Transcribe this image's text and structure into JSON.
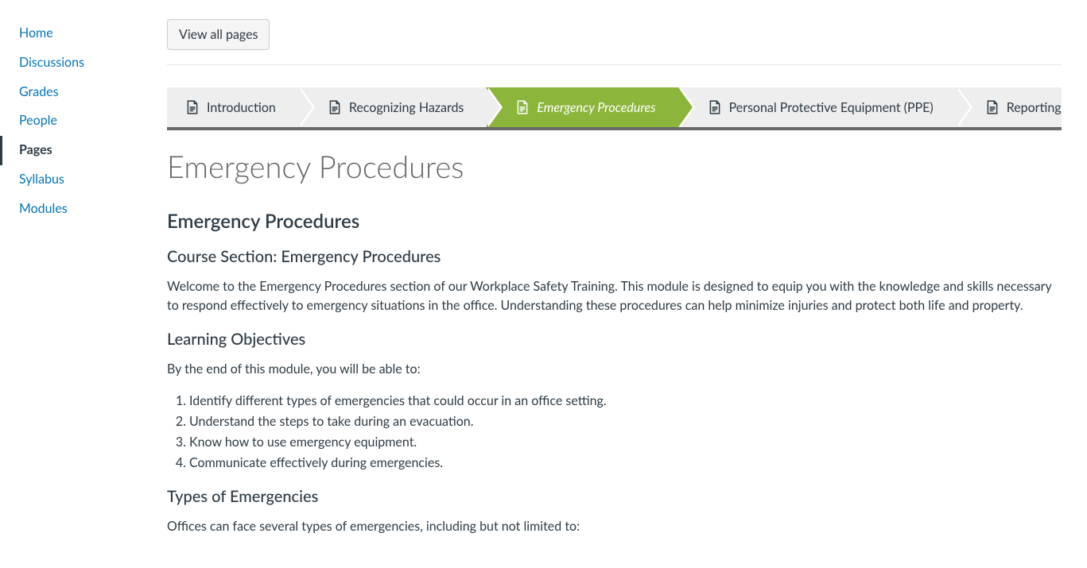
{
  "sidebar": {
    "items": [
      {
        "label": "Home",
        "active": false
      },
      {
        "label": "Discussions",
        "active": false
      },
      {
        "label": "Grades",
        "active": false
      },
      {
        "label": "People",
        "active": false
      },
      {
        "label": "Pages",
        "active": true
      },
      {
        "label": "Syllabus",
        "active": false
      },
      {
        "label": "Modules",
        "active": false
      }
    ]
  },
  "header": {
    "view_all_label": "View all pages"
  },
  "breadcrumb": {
    "items": [
      {
        "label": "Introduction",
        "active": false
      },
      {
        "label": "Recognizing Hazards",
        "active": false
      },
      {
        "label": "Emergency Procedures",
        "active": true
      },
      {
        "label": "Personal Protective Equipment (PPE)",
        "active": false
      },
      {
        "label": "Reporting Incidents",
        "active": false
      }
    ]
  },
  "page": {
    "title": "Emergency Procedures",
    "h2": "Emergency Procedures",
    "section_heading": "Course Section: Emergency Procedures",
    "intro": "Welcome to the Emergency Procedures section of our Workplace Safety Training. This module is designed to equip you with the knowledge and skills necessary to respond effectively to emergency situations in the office. Understanding these procedures can help minimize injuries and protect both life and property.",
    "objectives_heading": "Learning Objectives",
    "objectives_intro": "By the end of this module, you will be able to:",
    "objectives": [
      "Identify different types of emergencies that could occur in an office setting.",
      "Understand the steps to take during an evacuation.",
      "Know how to use emergency equipment.",
      "Communicate effectively during emergencies."
    ],
    "types_heading": "Types of Emergencies",
    "types_intro": "Offices can face several types of emergencies, including but not limited to:"
  }
}
